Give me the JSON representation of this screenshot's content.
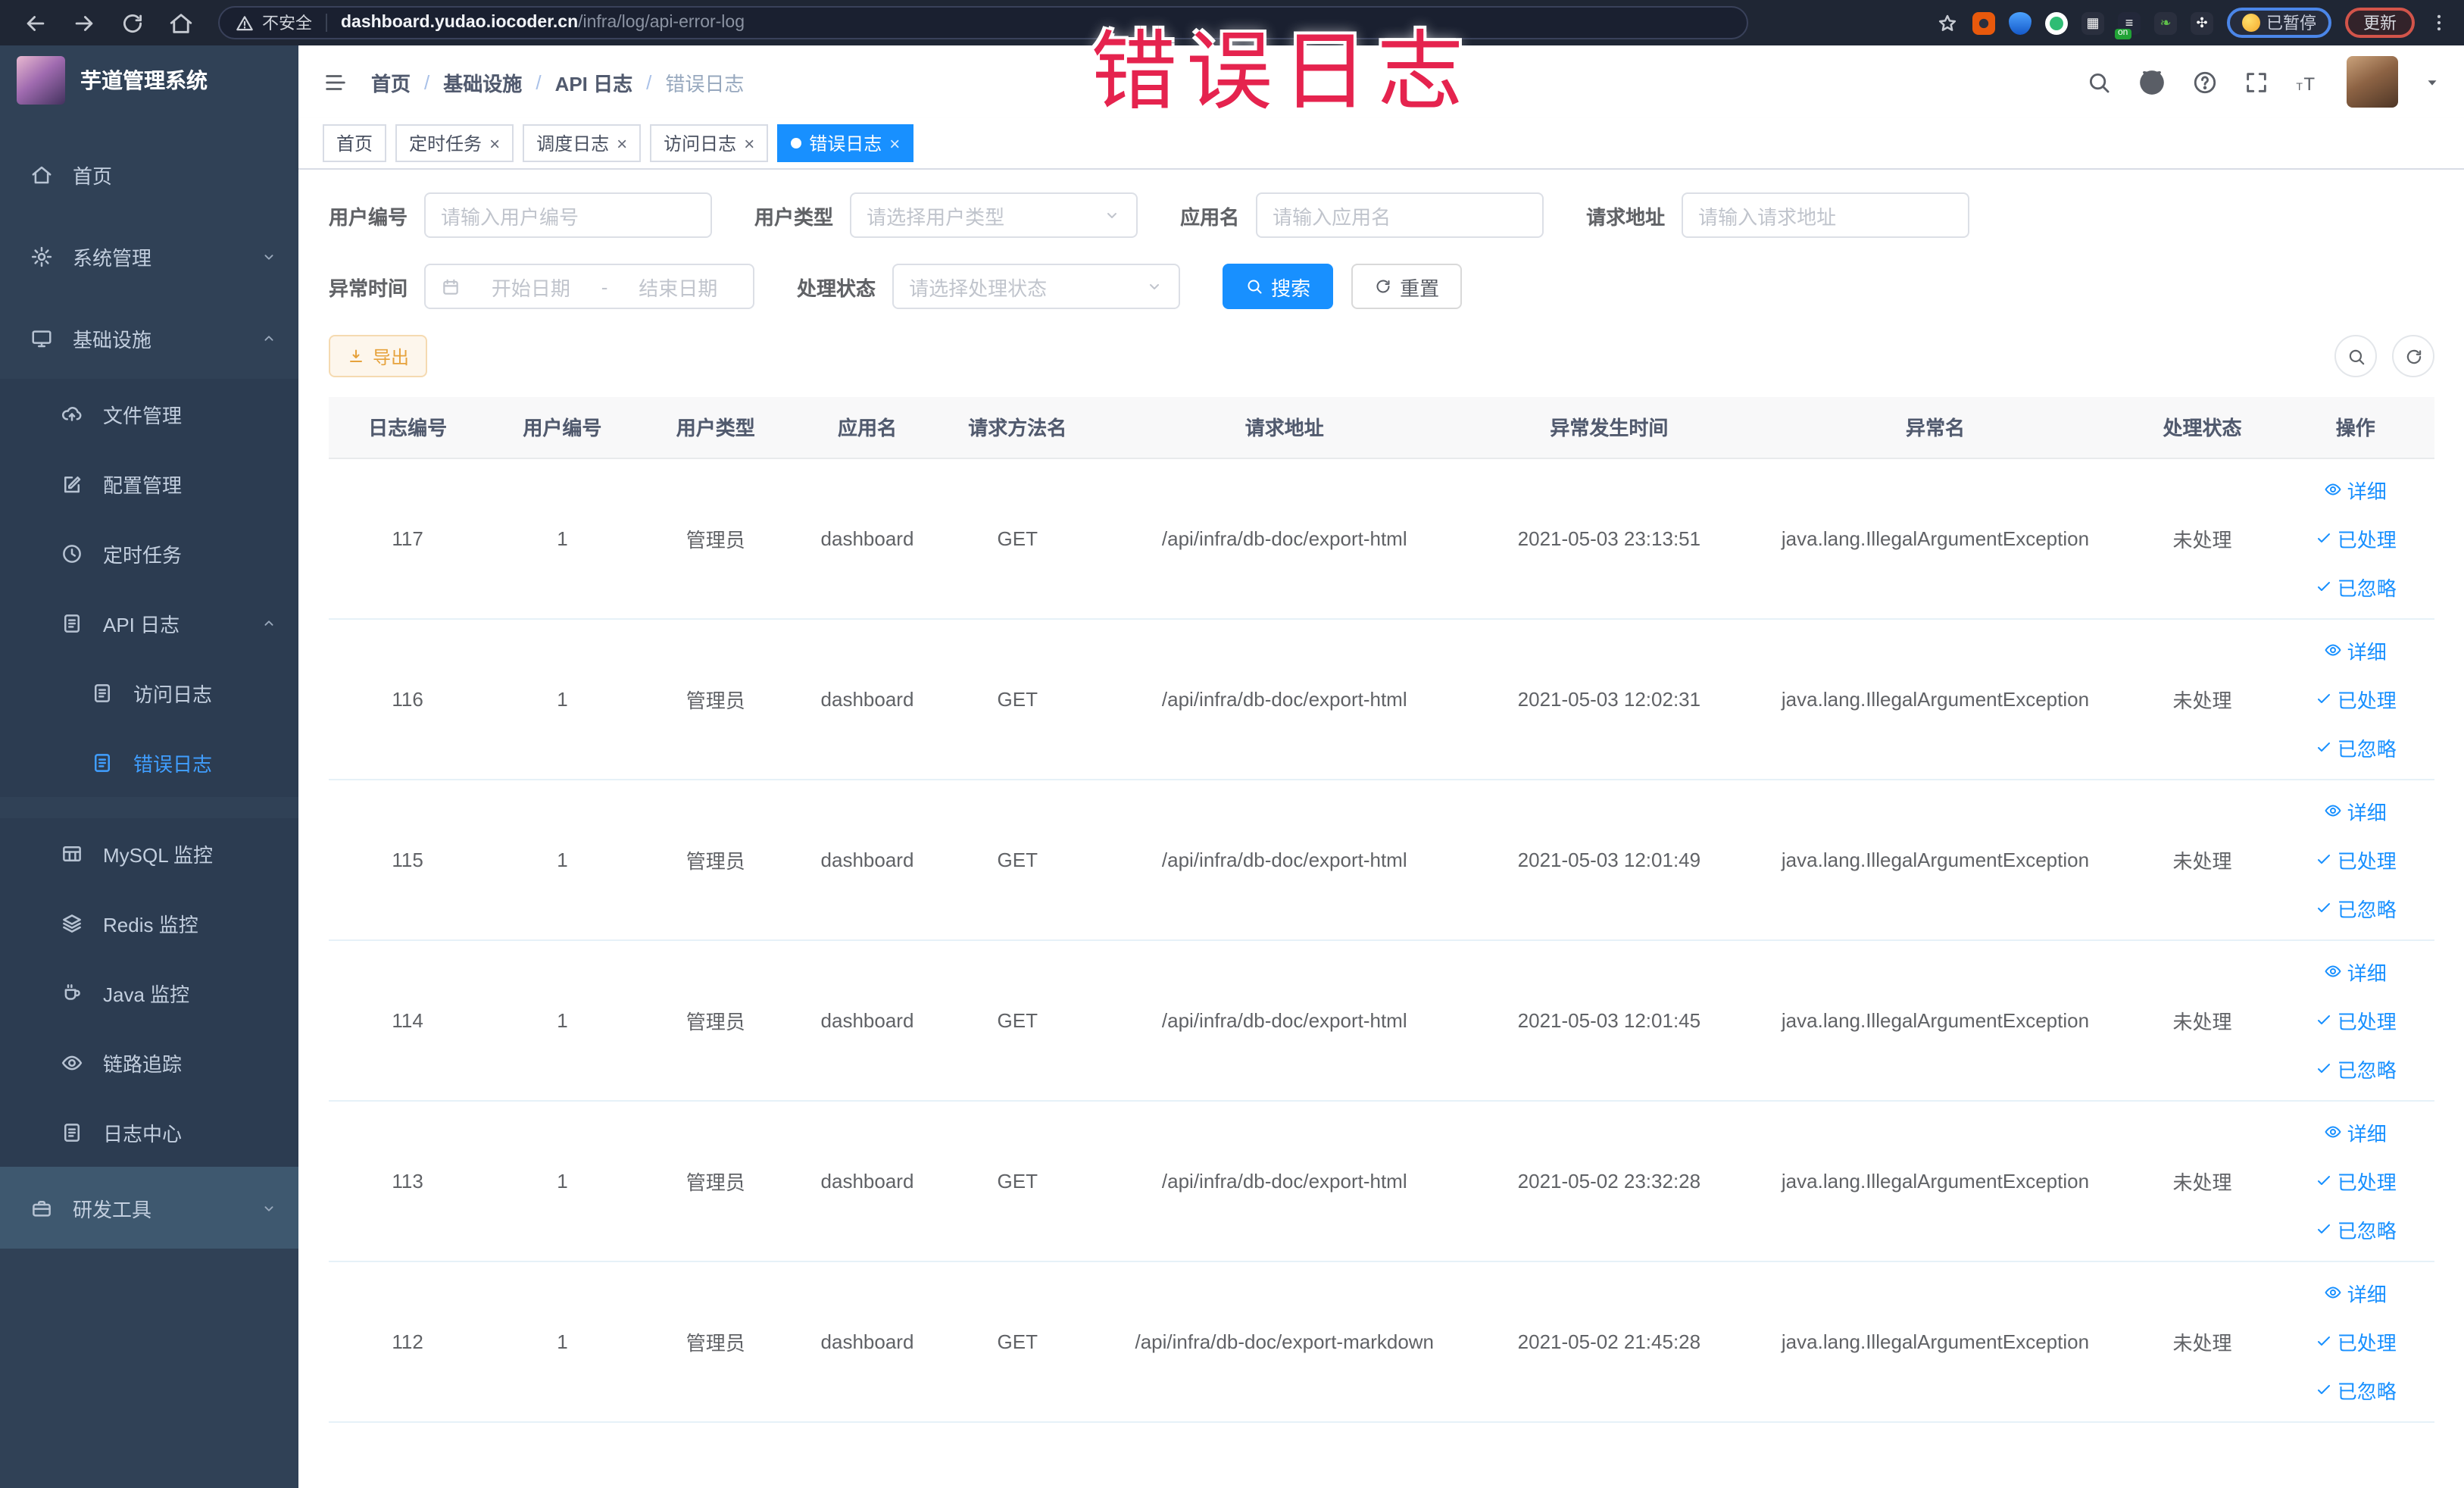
{
  "browser": {
    "security_label": "不安全",
    "url_domain": "dashboard.yudao.iocoder.cn",
    "url_path": "/infra/log/api-error-log",
    "paused_badge": "已暂停",
    "update_badge": "更新"
  },
  "overlay": {
    "title": "错误日志"
  },
  "colors": {
    "primary": "#1890ff",
    "sidebar_bg": "#304156",
    "sidebar_active_text": "#409eff",
    "warning_button": "#e6a23c",
    "overlay_red": "#e5234e",
    "table_header_bg": "#f8f8f9"
  },
  "sidebar": {
    "logo_title": "芋道管理系统",
    "items": [
      {
        "label": "首页",
        "icon": "home-icon",
        "level": 0
      },
      {
        "label": "系统管理",
        "icon": "gear-icon",
        "level": 0,
        "arrow": "down"
      },
      {
        "label": "基础设施",
        "icon": "monitor-icon",
        "level": 0,
        "arrow": "up"
      },
      {
        "label": "文件管理",
        "icon": "cloud-upload-icon",
        "level": 1
      },
      {
        "label": "配置管理",
        "icon": "edit-icon",
        "level": 1
      },
      {
        "label": "定时任务",
        "icon": "clock-icon",
        "level": 1
      },
      {
        "label": "API 日志",
        "icon": "log-icon",
        "level": 1,
        "arrow": "up"
      },
      {
        "label": "访问日志",
        "icon": "log-icon",
        "level": 2
      },
      {
        "label": "错误日志",
        "icon": "log-icon",
        "level": 2,
        "active": true,
        "gap_after": true
      },
      {
        "label": "MySQL 监控",
        "icon": "table-icon",
        "level": 1
      },
      {
        "label": "Redis 监控",
        "icon": "layers-icon",
        "level": 1
      },
      {
        "label": "Java 监控",
        "icon": "coffee-icon",
        "level": 1
      },
      {
        "label": "链路追踪",
        "icon": "eye-icon",
        "level": 1
      },
      {
        "label": "日志中心",
        "icon": "log-icon",
        "level": 1
      },
      {
        "label": "研发工具",
        "icon": "toolbox-icon",
        "level": 0,
        "arrow": "down",
        "hover": true
      }
    ]
  },
  "header": {
    "breadcrumb": [
      {
        "label": "首页"
      },
      {
        "label": "基础设施"
      },
      {
        "label": "API 日志"
      },
      {
        "label": "错误日志",
        "current": true
      }
    ]
  },
  "tabs": [
    {
      "label": "首页",
      "closable": false,
      "active": false
    },
    {
      "label": "定时任务",
      "closable": true,
      "active": false
    },
    {
      "label": "调度日志",
      "closable": true,
      "active": false
    },
    {
      "label": "访问日志",
      "closable": true,
      "active": false
    },
    {
      "label": "错误日志",
      "closable": true,
      "active": true
    }
  ],
  "filters": {
    "user_id": {
      "label": "用户编号",
      "placeholder": "请输入用户编号"
    },
    "user_type": {
      "label": "用户类型",
      "placeholder": "请选择用户类型"
    },
    "app_name": {
      "label": "应用名",
      "placeholder": "请输入应用名"
    },
    "request_url": {
      "label": "请求地址",
      "placeholder": "请输入请求地址"
    },
    "exception_time": {
      "label": "异常时间",
      "start_placeholder": "开始日期",
      "separator": "-",
      "end_placeholder": "结束日期"
    },
    "process_status": {
      "label": "处理状态",
      "placeholder": "请选择处理状态"
    },
    "search_label": "搜索",
    "reset_label": "重置"
  },
  "toolbar": {
    "export_label": "导出"
  },
  "table": {
    "columns": [
      "日志编号",
      "用户编号",
      "用户类型",
      "应用名",
      "请求方法名",
      "请求地址",
      "异常发生时间",
      "异常名",
      "处理状态",
      "操作"
    ],
    "op_labels": {
      "detail": "详细",
      "processed": "已处理",
      "ignored": "已忽略"
    },
    "rows": [
      {
        "id": "117",
        "user_id": "1",
        "user_type": "管理员",
        "app": "dashboard",
        "method": "GET",
        "url": "/api/infra/db-doc/export-html",
        "time": "2021-05-03 23:13:51",
        "exception": "java.lang.IllegalArgumentException",
        "status": "未处理"
      },
      {
        "id": "116",
        "user_id": "1",
        "user_type": "管理员",
        "app": "dashboard",
        "method": "GET",
        "url": "/api/infra/db-doc/export-html",
        "time": "2021-05-03 12:02:31",
        "exception": "java.lang.IllegalArgumentException",
        "status": "未处理"
      },
      {
        "id": "115",
        "user_id": "1",
        "user_type": "管理员",
        "app": "dashboard",
        "method": "GET",
        "url": "/api/infra/db-doc/export-html",
        "time": "2021-05-03 12:01:49",
        "exception": "java.lang.IllegalArgumentException",
        "status": "未处理"
      },
      {
        "id": "114",
        "user_id": "1",
        "user_type": "管理员",
        "app": "dashboard",
        "method": "GET",
        "url": "/api/infra/db-doc/export-html",
        "time": "2021-05-03 12:01:45",
        "exception": "java.lang.IllegalArgumentException",
        "status": "未处理"
      },
      {
        "id": "113",
        "user_id": "1",
        "user_type": "管理员",
        "app": "dashboard",
        "method": "GET",
        "url": "/api/infra/db-doc/export-html",
        "time": "2021-05-02 23:32:28",
        "exception": "java.lang.IllegalArgumentException",
        "status": "未处理"
      },
      {
        "id": "112",
        "user_id": "1",
        "user_type": "管理员",
        "app": "dashboard",
        "method": "GET",
        "url": "/api/infra/db-doc/export-markdown",
        "time": "2021-05-02 21:45:28",
        "exception": "java.lang.IllegalArgumentException",
        "status": "未处理"
      }
    ]
  }
}
